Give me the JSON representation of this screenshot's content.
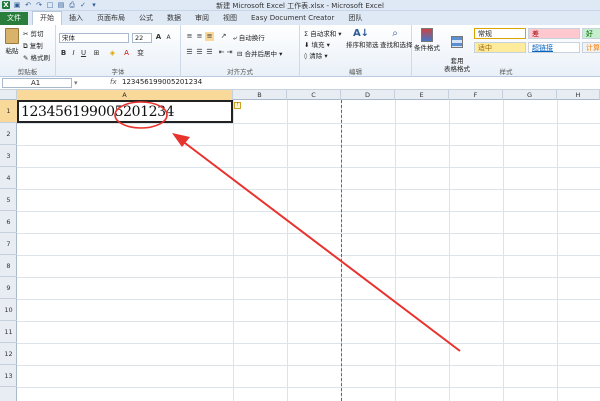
{
  "titlebar": {
    "title": "新建 Microsoft Excel 工作表.xlsx - Microsoft Excel"
  },
  "tabs": [
    "文件",
    "开始",
    "插入",
    "页面布局",
    "公式",
    "数据",
    "审阅",
    "视图",
    "Easy Document Creator",
    "团队"
  ],
  "ribbon": {
    "paste": "粘贴",
    "cut": "剪切",
    "copy": "复制",
    "format_painter": "格式刷",
    "clipboard_label": "剪贴板",
    "font_name": "宋体",
    "font_size": "22",
    "font_label": "字体",
    "wrap_text": "自动换行",
    "merge_center": "合并后居中",
    "alignment_label": "对齐方式",
    "autosum": "自动求和",
    "fill": "填充",
    "clear": "清除",
    "sort_filter": "排序和筛选",
    "find_select": "查找和选择",
    "editing_label": "编辑",
    "conditional_format": "条件格式",
    "format_table": "套用\n表格格式",
    "styles_label": "样式",
    "styles": {
      "normal": "常规",
      "bad": "差",
      "good": "好",
      "neutral": "适中",
      "hyperlink": "超链接",
      "calculation": "计算"
    }
  },
  "formula_bar": {
    "cell_ref": "A1",
    "fx": "fx",
    "content": "123456199005201234"
  },
  "columns": [
    "A",
    "B",
    "C",
    "D",
    "E",
    "F",
    "G",
    "H"
  ],
  "rows": [
    "1",
    "2",
    "3",
    "4",
    "5",
    "6",
    "7",
    "8",
    "9",
    "10",
    "11",
    "12",
    "13"
  ],
  "cell_a1": "123456199005201234",
  "colors": {
    "file_tab": "#2a7e3b",
    "annotation_red": "#e8322d",
    "selected_header": "#f9d99a"
  }
}
